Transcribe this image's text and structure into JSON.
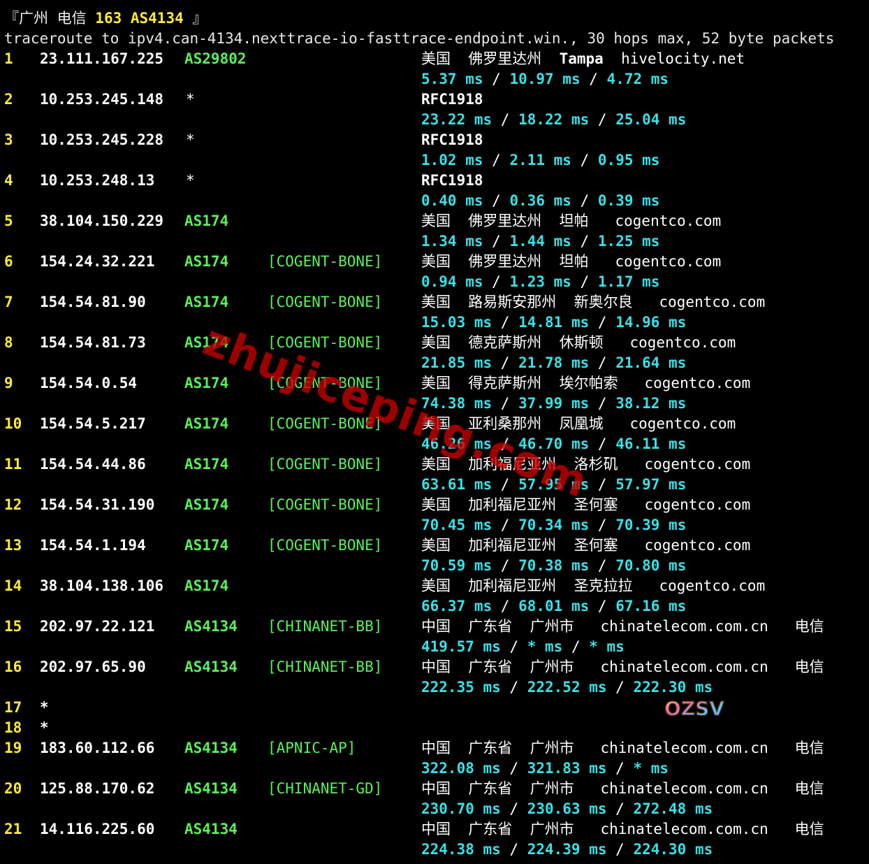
{
  "title": {
    "prefix": "『广州 电信 ",
    "bold": "163 AS4134",
    "suffix": " 』"
  },
  "command": "traceroute to ipv4.can-4134.nexttrace-io-fasttrace-endpoint.win., 30 hops max, 52 byte packets",
  "hops": [
    {
      "n": "1",
      "ip": "23.111.167.225",
      "asn": "AS29802",
      "tag": "",
      "geo": "美国  佛罗里达州  ",
      "geo_bold": "Tampa",
      "geo_tail": "  hivelocity.net",
      "rtt": [
        "5.37 ms",
        "10.97 ms",
        "4.72 ms"
      ]
    },
    {
      "n": "2",
      "ip": "10.253.245.148",
      "star": "*",
      "geo_bold": "RFC1918",
      "rtt": [
        "23.22 ms",
        "18.22 ms",
        "25.04 ms"
      ]
    },
    {
      "n": "3",
      "ip": "10.253.245.228",
      "star": "*",
      "geo_bold": "RFC1918",
      "rtt": [
        "1.02 ms",
        "2.11 ms",
        "0.95 ms"
      ]
    },
    {
      "n": "4",
      "ip": "10.253.248.13",
      "star": "*",
      "geo_bold": "RFC1918",
      "rtt": [
        "0.40 ms",
        "0.36 ms",
        "0.39 ms"
      ]
    },
    {
      "n": "5",
      "ip": "38.104.150.229",
      "asn": "AS174",
      "tag": "",
      "geo": "美国  佛罗里达州  坦帕   cogentco.com",
      "rtt": [
        "1.34 ms",
        "1.44 ms",
        "1.25 ms"
      ]
    },
    {
      "n": "6",
      "ip": "154.24.32.221",
      "asn": "AS174",
      "tag": "[COGENT-BONE]",
      "geo": "美国  佛罗里达州  坦帕   cogentco.com",
      "rtt": [
        "0.94 ms",
        "1.23 ms",
        "1.17 ms"
      ]
    },
    {
      "n": "7",
      "ip": "154.54.81.90",
      "asn": "AS174",
      "tag": "[COGENT-BONE]",
      "geo": "美国  路易斯安那州  新奥尔良   cogentco.com",
      "rtt": [
        "15.03 ms",
        "14.81 ms",
        "14.96 ms"
      ]
    },
    {
      "n": "8",
      "ip": "154.54.81.73",
      "asn": "AS174",
      "tag": "[COGENT-BONE]",
      "geo": "美国  德克萨斯州  休斯顿   cogentco.com",
      "rtt": [
        "21.85 ms",
        "21.78 ms",
        "21.64 ms"
      ]
    },
    {
      "n": "9",
      "ip": "154.54.0.54",
      "asn": "AS174",
      "tag": "[COGENT-BONE]",
      "geo": "美国  得克萨斯州  埃尔帕索   cogentco.com",
      "rtt": [
        "74.38 ms",
        "37.99 ms",
        "38.12 ms"
      ]
    },
    {
      "n": "10",
      "ip": "154.54.5.217",
      "asn": "AS174",
      "tag": "[COGENT-BONE]",
      "geo": "美国  亚利桑那州  凤凰城   cogentco.com",
      "rtt": [
        "46.26 ms",
        "46.70 ms",
        "46.11 ms"
      ]
    },
    {
      "n": "11",
      "ip": "154.54.44.86",
      "asn": "AS174",
      "tag": "[COGENT-BONE]",
      "geo": "美国  加利福尼亚州  洛杉矶   cogentco.com",
      "rtt": [
        "63.61 ms",
        "57.95 ms",
        "57.97 ms"
      ]
    },
    {
      "n": "12",
      "ip": "154.54.31.190",
      "asn": "AS174",
      "tag": "[COGENT-BONE]",
      "geo": "美国  加利福尼亚州  圣何塞   cogentco.com",
      "rtt": [
        "70.45 ms",
        "70.34 ms",
        "70.39 ms"
      ]
    },
    {
      "n": "13",
      "ip": "154.54.1.194",
      "asn": "AS174",
      "tag": "[COGENT-BONE]",
      "geo": "美国  加利福尼亚州  圣何塞   cogentco.com",
      "rtt": [
        "70.59 ms",
        "70.38 ms",
        "70.80 ms"
      ]
    },
    {
      "n": "14",
      "ip": "38.104.138.106",
      "asn": "AS174",
      "tag": "",
      "geo": "美国  加利福尼亚州  圣克拉拉   cogentco.com",
      "rtt": [
        "66.37 ms",
        "68.01 ms",
        "67.16 ms"
      ]
    },
    {
      "n": "15",
      "ip": "202.97.22.121",
      "asn": "AS4134",
      "tag": "[CHINANET-BB]",
      "geo": "中国  广东省  广州市   chinatelecom.com.cn   电信",
      "rtt": [
        "419.57 ms",
        "* ms",
        "* ms"
      ]
    },
    {
      "n": "16",
      "ip": "202.97.65.90",
      "asn": "AS4134",
      "tag": "[CHINANET-BB]",
      "geo": "中国  广东省  广州市   chinatelecom.com.cn   电信",
      "rtt": [
        "222.35 ms",
        "222.52 ms",
        "222.30 ms"
      ]
    },
    {
      "n": "17",
      "ip": "*"
    },
    {
      "n": "18",
      "ip": "*"
    },
    {
      "n": "19",
      "ip": "183.60.112.66",
      "asn": "AS4134",
      "tag": "[APNIC-AP]",
      "geo": "中国  广东省  广州市   chinatelecom.com.cn   电信",
      "rtt": [
        "322.08 ms",
        "321.83 ms",
        "* ms"
      ]
    },
    {
      "n": "20",
      "ip": "125.88.170.62",
      "asn": "AS4134",
      "tag": "[CHINANET-GD]",
      "geo": "中国  广东省  广州市   chinatelecom.com.cn   电信",
      "rtt": [
        "230.70 ms",
        "230.63 ms",
        "272.48 ms"
      ]
    },
    {
      "n": "21",
      "ip": "14.116.225.60",
      "asn": "AS4134",
      "tag": "",
      "geo": "中国  广东省  广州市   chinatelecom.com.cn   电信",
      "rtt": [
        "224.38 ms",
        "224.39 ms",
        "224.30 ms"
      ]
    }
  ],
  "rtt_separator": " / ",
  "watermark": "zhujiceping.com",
  "logo_text": "OZSV",
  "colors": {
    "background": "#000000",
    "hop_number": "#ffea3b",
    "asn": "#5af05a",
    "rtt": "#39e0e6",
    "watermark": "#c80000"
  }
}
